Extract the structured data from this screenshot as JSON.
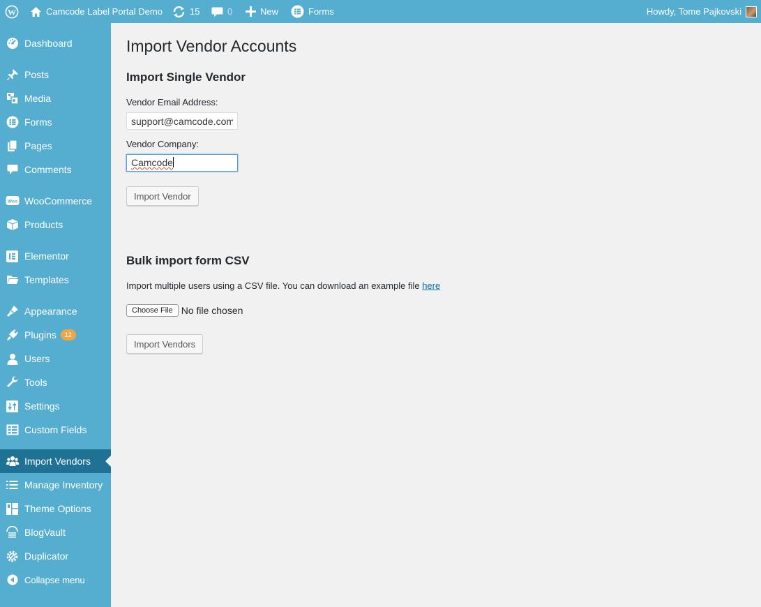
{
  "adminbar": {
    "site_name": "Camcode Label Portal Demo",
    "updates_count": "15",
    "comments_count": "0",
    "new_label": "New",
    "forms_label": "Forms",
    "howdy": "Howdy, Tome Pajkovski"
  },
  "sidebar": {
    "items": [
      {
        "label": "Dashboard",
        "icon": "dashboard-icon"
      },
      {
        "label": "Posts",
        "icon": "pin-icon"
      },
      {
        "label": "Media",
        "icon": "media-icon"
      },
      {
        "label": "Forms",
        "icon": "forms-icon"
      },
      {
        "label": "Pages",
        "icon": "pages-icon"
      },
      {
        "label": "Comments",
        "icon": "comment-icon"
      },
      {
        "label": "WooCommerce",
        "icon": "woocommerce-icon"
      },
      {
        "label": "Products",
        "icon": "box-icon"
      },
      {
        "label": "Elementor",
        "icon": "elementor-icon"
      },
      {
        "label": "Templates",
        "icon": "folder-icon"
      },
      {
        "label": "Appearance",
        "icon": "brush-icon"
      },
      {
        "label": "Plugins",
        "icon": "plug-icon",
        "badge": "12"
      },
      {
        "label": "Users",
        "icon": "user-icon"
      },
      {
        "label": "Tools",
        "icon": "wrench-icon"
      },
      {
        "label": "Settings",
        "icon": "sliders-icon"
      },
      {
        "label": "Custom Fields",
        "icon": "table-icon"
      },
      {
        "label": "Import Vendors",
        "icon": "groups-icon",
        "current": true
      },
      {
        "label": "Manage Inventory",
        "icon": "list-icon"
      },
      {
        "label": "Theme Options",
        "icon": "layout-icon"
      },
      {
        "label": "BlogVault",
        "icon": "vault-icon"
      },
      {
        "label": "Duplicator",
        "icon": "gear-icon"
      }
    ],
    "collapse_label": "Collapse menu"
  },
  "main": {
    "page_title": "Import Vendor Accounts",
    "single": {
      "heading": "Import Single Vendor",
      "email_label": "Vendor Email Address:",
      "email_value": "support@camcode.com",
      "company_label": "Vendor Company:",
      "company_value": "Camcode",
      "button": "Import Vendor"
    },
    "bulk": {
      "heading": "Bulk import form CSV",
      "description": "Import multiple users using a CSV file. You can download an example file ",
      "link_text": "here",
      "choose_file": "Choose File",
      "file_status": "No file chosen",
      "button": "Import Vendors"
    }
  },
  "colors": {
    "sidebar_bg": "#55aecf",
    "current_bg": "#1f7294",
    "badge": "#f0a646",
    "link": "#0073aa"
  }
}
